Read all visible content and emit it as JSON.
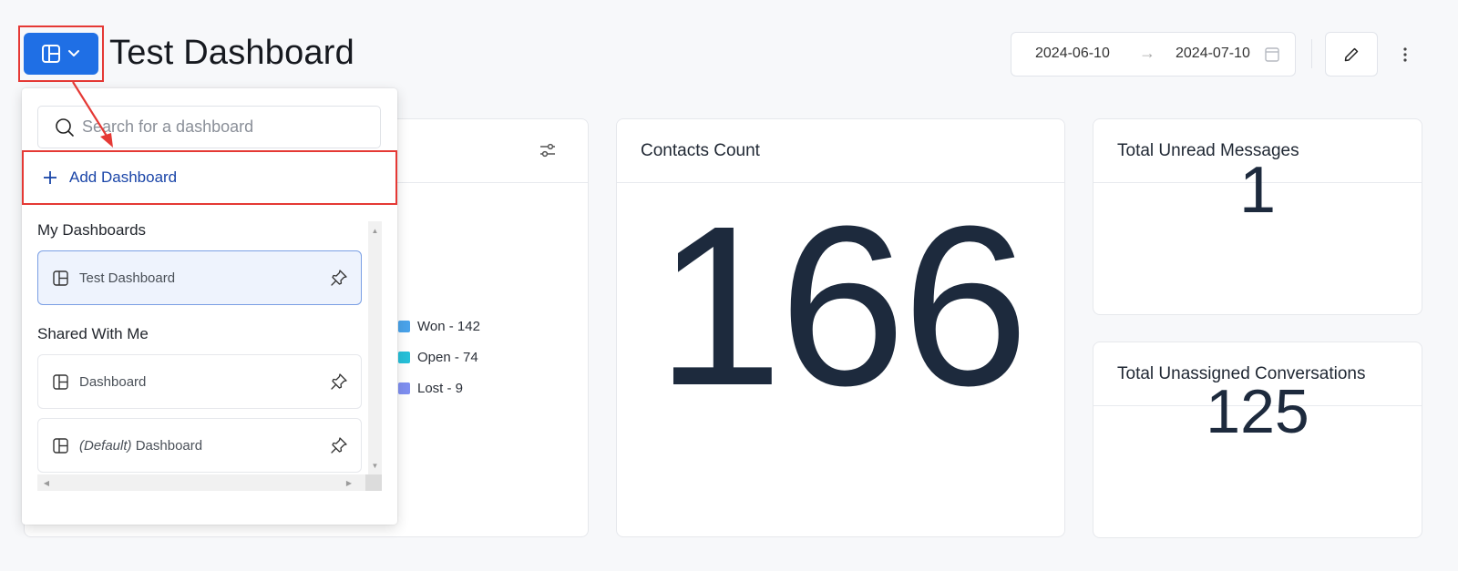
{
  "header": {
    "title": "Test Dashboard",
    "date_start": "2024-06-10",
    "date_arrow": "→",
    "date_end": "2024-07-10"
  },
  "dropdown": {
    "search_placeholder": "Search for a dashboard",
    "add_label": "Add Dashboard",
    "sections": [
      {
        "label": "My Dashboards",
        "items": [
          {
            "label": "Test Dashboard",
            "selected": true
          }
        ]
      },
      {
        "label": "Shared With Me",
        "items": [
          {
            "label": "Dashboard"
          },
          {
            "prefix": "(Default)",
            "label": "Dashboard"
          }
        ]
      }
    ]
  },
  "cards": {
    "deals_legend": [
      {
        "label": "Won - 142",
        "color": "#4aa3ea"
      },
      {
        "label": "Open - 74",
        "color": "#26c0d9"
      },
      {
        "label": "Lost - 9",
        "color": "#7f8ff0"
      }
    ],
    "contacts": {
      "title": "Contacts Count",
      "value": "166"
    },
    "unread": {
      "title": "Total Unread Messages",
      "value": "1"
    },
    "unassigned": {
      "title": "Total Unassigned Conversations",
      "value": "125"
    }
  },
  "colors": {
    "accent": "#1f6fe5",
    "annotation": "#e53935",
    "link": "#1a45a8"
  }
}
